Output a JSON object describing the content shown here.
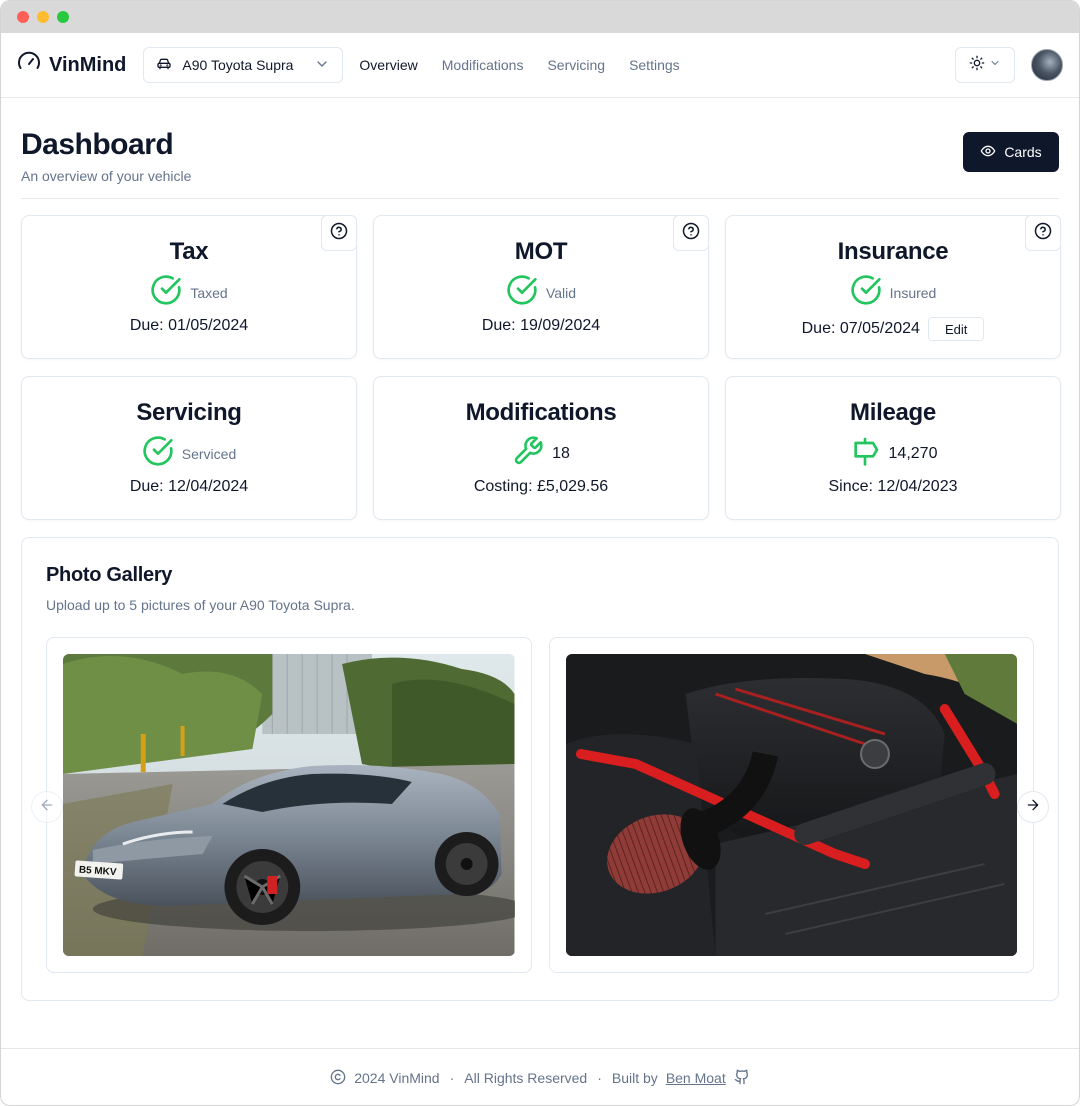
{
  "brand": {
    "name": "VinMind",
    "icon": "gauge-icon"
  },
  "vehicle_select": {
    "value": "A90 Toyota Supra",
    "icon": "car-icon"
  },
  "nav": {
    "items": [
      {
        "label": "Overview",
        "active": true
      },
      {
        "label": "Modifications",
        "active": false
      },
      {
        "label": "Servicing",
        "active": false
      },
      {
        "label": "Settings",
        "active": false
      }
    ]
  },
  "theme_toggle": {
    "icon": "sun-icon"
  },
  "header": {
    "title": "Dashboard",
    "subtitle": "An overview of your vehicle",
    "cards_button": "Cards"
  },
  "cards": {
    "tax": {
      "title": "Tax",
      "status": "Taxed",
      "detail": "Due: 01/05/2024"
    },
    "mot": {
      "title": "MOT",
      "status": "Valid",
      "detail": "Due: 19/09/2024"
    },
    "insurance": {
      "title": "Insurance",
      "status": "Insured",
      "detail": "Due: 07/05/2024",
      "edit_label": "Edit"
    },
    "servicing": {
      "title": "Servicing",
      "status": "Serviced",
      "detail": "Due: 12/04/2024"
    },
    "modifications": {
      "title": "Modifications",
      "count": "18",
      "detail": "Costing: £5,029.56"
    },
    "mileage": {
      "title": "Mileage",
      "value": "14,270",
      "detail": "Since: 12/04/2023"
    }
  },
  "gallery": {
    "title": "Photo Gallery",
    "subtitle": "Upload up to 5 pictures of your A90 Toyota Supra.",
    "plate_text": "B5 MKV"
  },
  "footer": {
    "copyright": "2024 VinMind",
    "rights": "All Rights Reserved",
    "built_by": "Built by",
    "author": "Ben Moat"
  },
  "colors": {
    "accent": "#0f172a",
    "success": "#22c55e",
    "muted": "#64748b",
    "border": "#e2e8f0"
  }
}
